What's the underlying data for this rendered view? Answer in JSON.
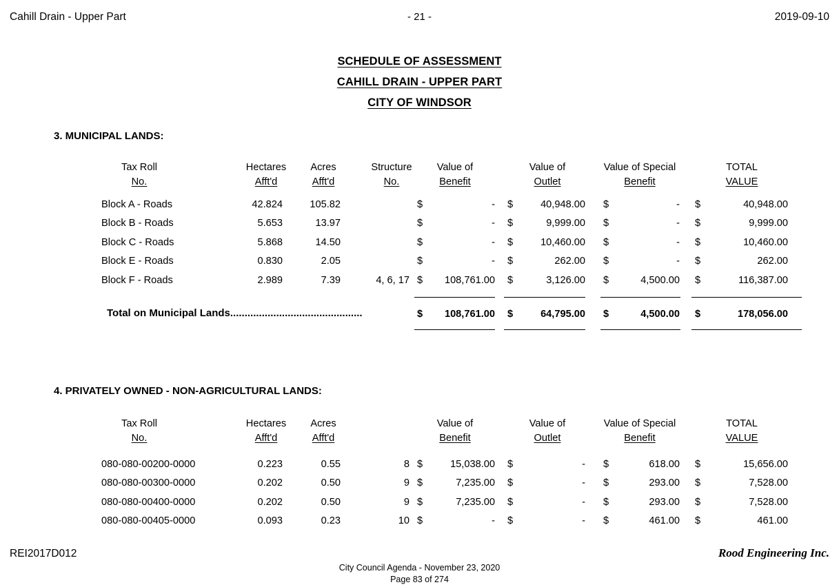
{
  "running_header": {
    "left": "Cahill Drain - Upper Part",
    "page_marker": "- 21 -",
    "date": "2019-09-10"
  },
  "titles": [
    "SCHEDULE OF ASSESSMENT",
    "CAHILL DRAIN - UPPER PART",
    "CITY OF WINDSOR"
  ],
  "columns": {
    "tax_roll": {
      "line1": "Tax Roll",
      "line2": "No."
    },
    "hectares": {
      "line1": "Hectares",
      "line2": "Afft'd"
    },
    "acres": {
      "line1": "Acres",
      "line2": "Afft'd"
    },
    "structure": {
      "line1": "Structure",
      "line2": "No."
    },
    "benefit": {
      "line1": "Value of",
      "line2": "Benefit"
    },
    "outlet": {
      "line1": "Value of",
      "line2": "Outlet"
    },
    "special": {
      "line1": "Value of Special",
      "line2": "Benefit"
    },
    "total": {
      "line1": "TOTAL",
      "line2": "VALUE"
    }
  },
  "currency_symbol": "$",
  "dash": "-",
  "section3": {
    "heading": "3. MUNICIPAL LANDS:",
    "rows": [
      {
        "tax_roll": "Block A - Roads",
        "hectares": "42.824",
        "acres": "105.82",
        "structure": "",
        "benefit": "-",
        "outlet": "40,948.00",
        "special": "-",
        "total": "40,948.00"
      },
      {
        "tax_roll": "Block B - Roads",
        "hectares": "5.653",
        "acres": "13.97",
        "structure": "",
        "benefit": "-",
        "outlet": "9,999.00",
        "special": "-",
        "total": "9,999.00"
      },
      {
        "tax_roll": "Block C - Roads",
        "hectares": "5.868",
        "acres": "14.50",
        "structure": "",
        "benefit": "-",
        "outlet": "10,460.00",
        "special": "-",
        "total": "10,460.00"
      },
      {
        "tax_roll": "Block E - Roads",
        "hectares": "0.830",
        "acres": "2.05",
        "structure": "",
        "benefit": "-",
        "outlet": "262.00",
        "special": "-",
        "total": "262.00"
      },
      {
        "tax_roll": "Block F - Roads",
        "hectares": "2.989",
        "acres": "7.39",
        "structure": "4, 6, 17",
        "benefit": "108,761.00",
        "outlet": "3,126.00",
        "special": "4,500.00",
        "total": "116,387.00"
      }
    ],
    "total_label": "Total on Municipal Lands..............................................",
    "totals": {
      "benefit": "108,761.00",
      "outlet": "64,795.00",
      "special": "4,500.00",
      "total": "178,056.00"
    }
  },
  "section4": {
    "heading": "4. PRIVATELY OWNED - NON-AGRICULTURAL LANDS:",
    "rows": [
      {
        "tax_roll": "080-080-00200-0000",
        "hectares": "0.223",
        "acres": "0.55",
        "structure": "8",
        "benefit": "15,038.00",
        "outlet": "-",
        "special": "618.00",
        "total": "15,656.00"
      },
      {
        "tax_roll": "080-080-00300-0000",
        "hectares": "0.202",
        "acres": "0.50",
        "structure": "9",
        "benefit": "7,235.00",
        "outlet": "-",
        "special": "293.00",
        "total": "7,528.00"
      },
      {
        "tax_roll": "080-080-00400-0000",
        "hectares": "0.202",
        "acres": "0.50",
        "structure": "9",
        "benefit": "7,235.00",
        "outlet": "-",
        "special": "293.00",
        "total": "7,528.00"
      },
      {
        "tax_roll": "080-080-00405-0000",
        "hectares": "0.093",
        "acres": "0.23",
        "structure": "10",
        "benefit": "-",
        "outlet": "-",
        "special": "461.00",
        "total": "461.00"
      }
    ]
  },
  "footer": {
    "doc_id": "REI2017D012",
    "firm": "Rood Engineering Inc.",
    "agenda_line": "City Council Agenda - November 23, 2020",
    "page_line": "Page 83 of 274"
  }
}
